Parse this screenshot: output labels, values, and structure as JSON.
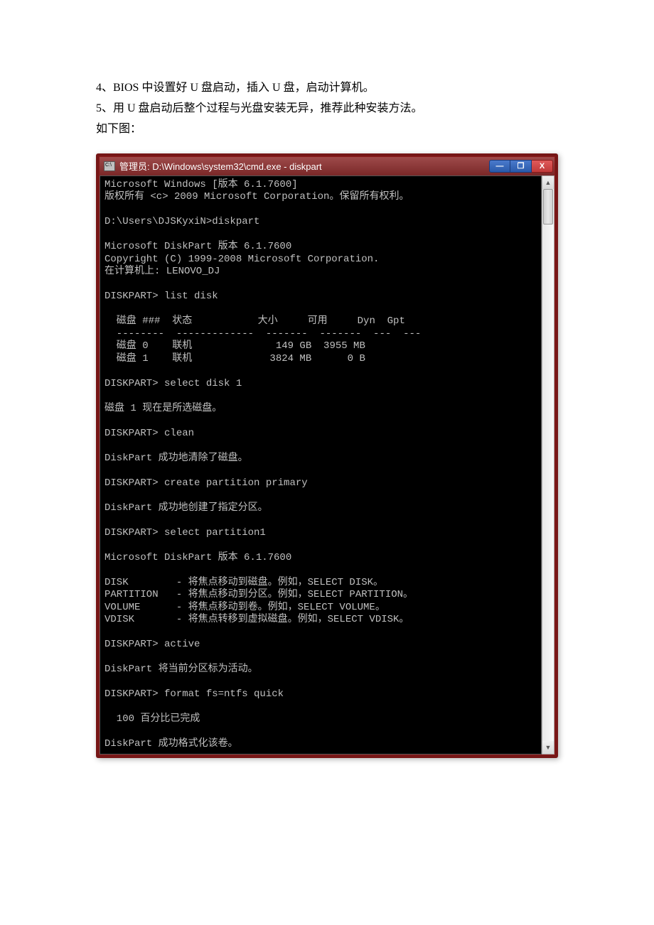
{
  "doc": {
    "line1": "4、BIOS 中设置好 U 盘启动，插入 U 盘，启动计算机。",
    "line2": "5、用 U 盘启动后整个过程与光盘安装无异，推荐此种安装方法。",
    "line3": "如下图："
  },
  "window": {
    "title": "管理员: D:\\Windows\\system32\\cmd.exe - diskpart",
    "min_label": "—",
    "max_label": "❐",
    "close_label": "X"
  },
  "term": {
    "l01": "Microsoft Windows [版本 6.1.7600]",
    "l02": "版权所有 <c> 2009 Microsoft Corporation。保留所有权利。",
    "l03": "",
    "l04": "D:\\Users\\DJSKyxiN>diskpart",
    "l05": "",
    "l06": "Microsoft DiskPart 版本 6.1.7600",
    "l07": "Copyright (C) 1999-2008 Microsoft Corporation.",
    "l08": "在计算机上: LENOVO_DJ",
    "l09": "",
    "l10": "DISKPART> list disk",
    "l11": "",
    "l12": "  磁盘 ###  状态           大小     可用     Dyn  Gpt",
    "l13": "  --------  -------------  -------  -------  ---  ---",
    "l14": "  磁盘 0    联机              149 GB  3955 MB",
    "l15": "  磁盘 1    联机             3824 MB      0 B",
    "l16": "",
    "l17": "DISKPART> select disk 1",
    "l18": "",
    "l19": "磁盘 1 现在是所选磁盘。",
    "l20": "",
    "l21": "DISKPART> clean",
    "l22": "",
    "l23": "DiskPart 成功地清除了磁盘。",
    "l24": "",
    "l25": "DISKPART> create partition primary",
    "l26": "",
    "l27": "DiskPart 成功地创建了指定分区。",
    "l28": "",
    "l29": "DISKPART> select partition1",
    "l30": "",
    "l31": "Microsoft DiskPart 版本 6.1.7600",
    "l32": "",
    "l33": "DISK        - 将焦点移动到磁盘。例如，SELECT DISK。",
    "l34": "PARTITION   - 将焦点移动到分区。例如，SELECT PARTITION。",
    "l35": "VOLUME      - 将焦点移动到卷。例如，SELECT VOLUME。",
    "l36": "VDISK       - 将焦点转移到虚拟磁盘。例如，SELECT VDISK。",
    "l37": "",
    "l38": "DISKPART> active",
    "l39": "",
    "l40": "DiskPart 将当前分区标为活动。",
    "l41": "",
    "l42": "DISKPART> format fs=ntfs quick",
    "l43": "",
    "l44": "  100 百分比已完成",
    "l45": "",
    "l46": "DiskPart 成功格式化该卷。",
    "l47": ""
  },
  "scroll": {
    "up": "▲",
    "down": "▼"
  }
}
